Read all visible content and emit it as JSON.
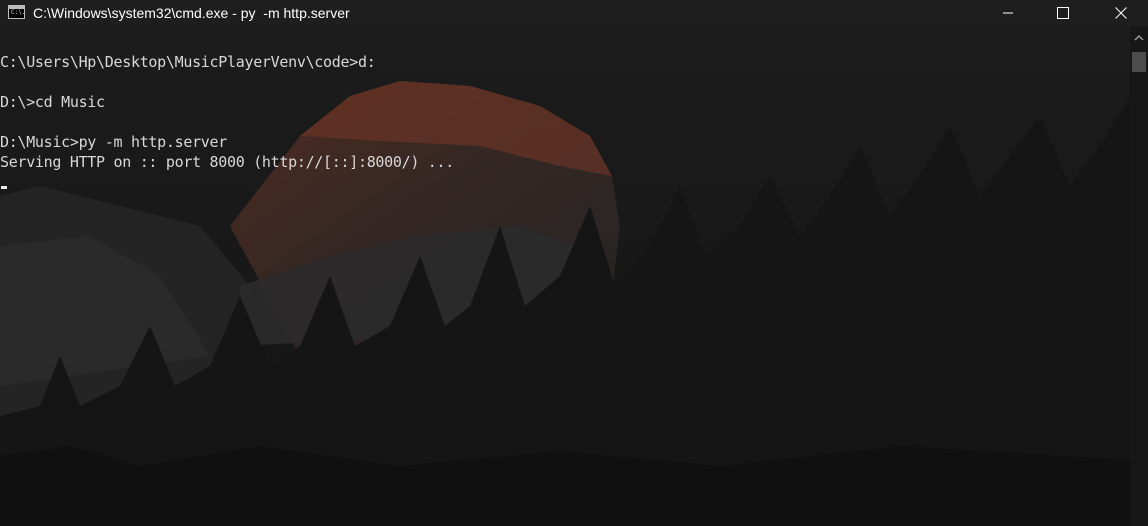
{
  "window": {
    "title": "C:\\Windows\\system32\\cmd.exe - py  -m http.server",
    "icon": "cmd-app-icon",
    "icon_text": "C:\\."
  },
  "console": {
    "lines": [
      "C:\\Users\\Hp\\Desktop\\MusicPlayerVenv\\code>d:",
      "",
      "D:\\>cd Music",
      "",
      "D:\\Music>py -m http.server",
      "Serving HTTP on :: port 8000 (http://[::]:8000/) ..."
    ]
  },
  "colors": {
    "titlebar": "#1e1e1e",
    "console_text": "#d8d8d8",
    "background": "#121212"
  }
}
